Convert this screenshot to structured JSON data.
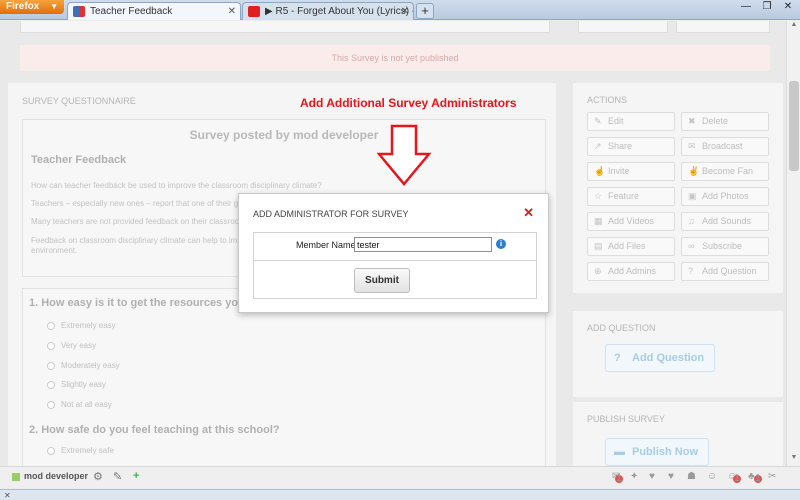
{
  "browser": {
    "app_button": "Firefox",
    "tabs": [
      {
        "title": "Teacher Feedback",
        "active": true
      },
      {
        "title": "▶ R5 - Forget About You (Lyrics) - Yo...",
        "active": false
      }
    ],
    "new_tab": "+"
  },
  "page": {
    "notice": "This Survey is not yet published",
    "questionnaire_label": "SURVEY QUESTIONNAIRE",
    "survey": {
      "posted_by": "Survey posted by mod developer",
      "title": "Teacher Feedback",
      "paragraphs": [
        "How can teacher feedback be used to improve the classroom disciplinary climate?",
        "Teachers – especially new ones – report that one of their g",
        "Many teachers are not provided feedback on their classroo",
        "Feedback on classroom disciplinary climate can help to im",
        "environment."
      ]
    },
    "questions": [
      {
        "title": "1. How easy is it to get the resources you n",
        "options": [
          "Extremely easy",
          "Very easy",
          "Moderately easy",
          "Slightly easy",
          "Not at all easy"
        ]
      },
      {
        "title": "2. How safe do you feel teaching at this school?",
        "options": [
          "Extremely safe"
        ]
      }
    ],
    "actions": {
      "label": "ACTIONS",
      "buttons": [
        {
          "label": "Edit",
          "icon": "edit-icon"
        },
        {
          "label": "Delete",
          "icon": "delete-icon"
        },
        {
          "label": "Share",
          "icon": "share-icon"
        },
        {
          "label": "Broadcast",
          "icon": "broadcast-icon"
        },
        {
          "label": "Invite",
          "icon": "invite-icon"
        },
        {
          "label": "Become Fan",
          "icon": "thumbs-up-icon"
        },
        {
          "label": "Feature",
          "icon": "star-icon"
        },
        {
          "label": "Add Photos",
          "icon": "photo-icon"
        },
        {
          "label": "Add Videos",
          "icon": "video-icon"
        },
        {
          "label": "Add Sounds",
          "icon": "music-icon"
        },
        {
          "label": "Add Files",
          "icon": "file-icon"
        },
        {
          "label": "Subscribe",
          "icon": "link-icon"
        },
        {
          "label": "Add Admins",
          "icon": "add-circle-icon"
        },
        {
          "label": "Add Question",
          "icon": "question-icon"
        }
      ]
    },
    "add_question": {
      "label": "ADD QUESTION",
      "button": "Add Question"
    },
    "publish": {
      "label": "PUBLISH SURVEY",
      "button": "Publish Now"
    }
  },
  "annotation": {
    "text": "Add Additional Survey Administrators",
    "color": "#e8161b"
  },
  "modal": {
    "title": "ADD ADMINISTRATOR FOR SURVEY",
    "close": "✕",
    "field_label": "Member Name:",
    "field_value": "tester",
    "info": "i",
    "submit": "Submit"
  },
  "footer": {
    "user": "mod developer",
    "badges": [
      "1",
      "1",
      "1"
    ]
  }
}
